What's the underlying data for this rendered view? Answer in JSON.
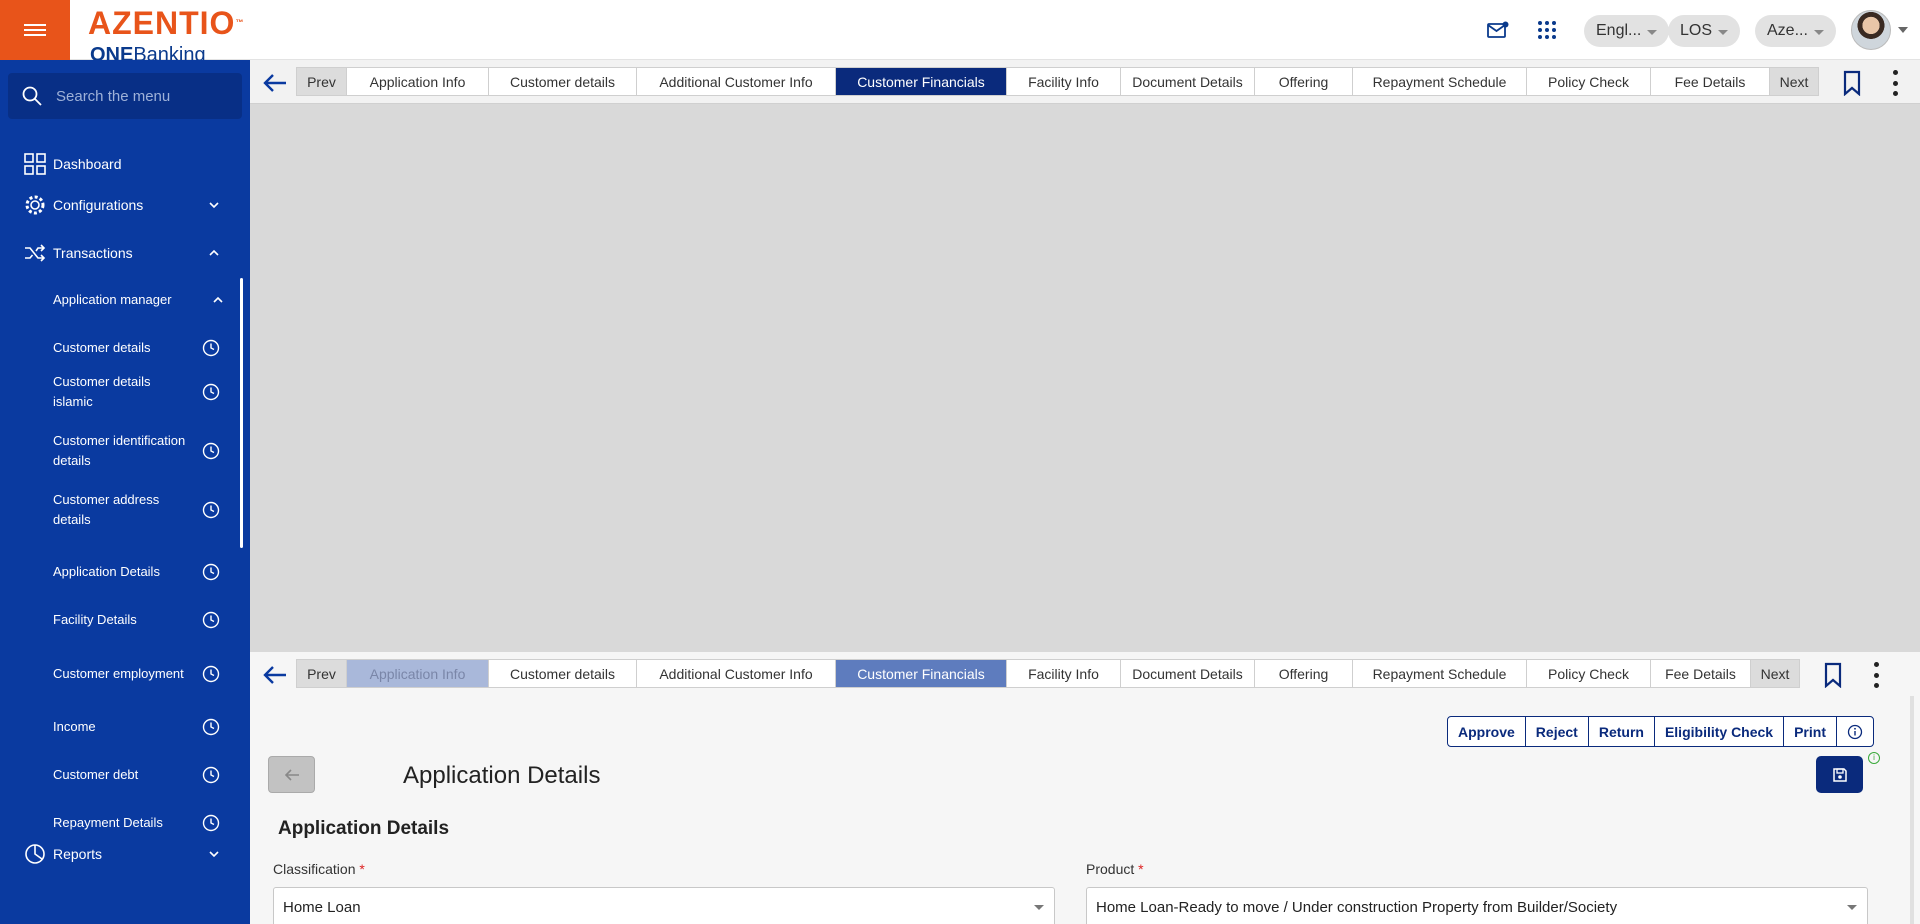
{
  "header": {
    "logo_main": "AZENTIO",
    "logo_tm": "™",
    "logo_sub_bold": "ONE",
    "logo_sub_rest": "Banking",
    "language": "Engl...",
    "module": "LOS",
    "entity": "Aze...",
    "icons": [
      "menu-icon",
      "mail-icon",
      "apps-grid-icon",
      "avatar"
    ]
  },
  "sidebar": {
    "search_placeholder": "Search the menu",
    "items": [
      {
        "label": "Dashboard",
        "icon": "dashboard-icon"
      },
      {
        "label": "Configurations",
        "icon": "gear-icon"
      },
      {
        "label": "Transactions",
        "icon": "shuffle-icon"
      },
      {
        "label": "Application manager"
      },
      {
        "label": "Reports",
        "icon": "pie-chart-icon"
      }
    ],
    "sub_items": [
      {
        "label": "Customer details"
      },
      {
        "label": "Customer details islamic"
      },
      {
        "label": "Customer identification details"
      },
      {
        "label": "Customer address details"
      },
      {
        "label": "Application Details"
      },
      {
        "label": "Facility Details"
      },
      {
        "label": "Customer employment"
      },
      {
        "label": "Income"
      },
      {
        "label": "Customer debt"
      },
      {
        "label": "Repayment Details"
      }
    ]
  },
  "tabs": {
    "prev": "Prev",
    "next": "Next",
    "items": [
      "Application Info",
      "Customer details",
      "Additional Customer Info",
      "Customer Financials",
      "Facility Info",
      "Document Details",
      "Offering",
      "Repayment Schedule",
      "Policy Check",
      "Fee Details"
    ],
    "active": "Customer Financials"
  },
  "actions": {
    "approve": "Approve",
    "reject": "Reject",
    "return": "Return",
    "eligibility": "Eligibility Check",
    "print": "Print"
  },
  "form": {
    "page_title": "Application Details",
    "section_title": "Application Details",
    "classification_label": "Classification",
    "classification_value": "Home Loan",
    "product_label": "Product",
    "product_value": "Home Loan-Ready to move / Under construction Property from Builder/Society",
    "required_mark": "*"
  },
  "colors": {
    "brand_orange": "#e8541a",
    "sidebar_blue": "#0a3aa0",
    "active_tab": "#0a2a7c"
  }
}
